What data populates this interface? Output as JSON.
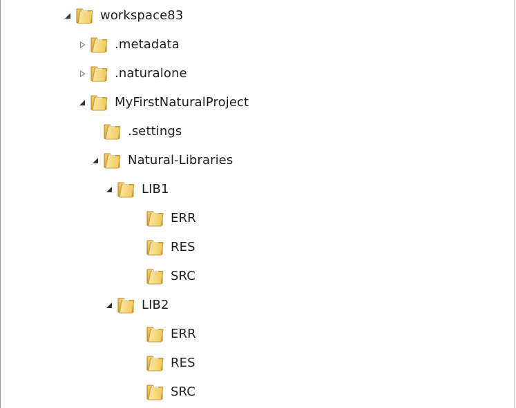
{
  "tree": {
    "nodes": [
      {
        "label": "workspace83",
        "depth": 0,
        "state": "expanded",
        "icon": "folder-icon"
      },
      {
        "label": ".metadata",
        "depth": 1,
        "state": "collapsed",
        "icon": "folder-icon"
      },
      {
        "label": ".naturalone",
        "depth": 1,
        "state": "collapsed",
        "icon": "folder-icon"
      },
      {
        "label": "MyFirstNaturalProject",
        "depth": 1,
        "state": "expanded",
        "icon": "folder-icon"
      },
      {
        "label": ".settings",
        "depth": 2,
        "state": "leaf",
        "icon": "folder-icon"
      },
      {
        "label": "Natural-Libraries",
        "depth": 2,
        "state": "expanded",
        "icon": "folder-icon"
      },
      {
        "label": "LIB1",
        "depth": 3,
        "state": "expanded",
        "icon": "folder-icon"
      },
      {
        "label": "ERR",
        "depth": 4,
        "state": "leaf",
        "icon": "folder-icon"
      },
      {
        "label": "RES",
        "depth": 4,
        "state": "leaf",
        "icon": "folder-icon"
      },
      {
        "label": "SRC",
        "depth": 4,
        "state": "leaf",
        "icon": "folder-icon"
      },
      {
        "label": "LIB2",
        "depth": 3,
        "state": "expanded",
        "icon": "folder-icon"
      },
      {
        "label": "ERR",
        "depth": 4,
        "state": "leaf",
        "icon": "folder-icon"
      },
      {
        "label": "RES",
        "depth": 4,
        "state": "leaf",
        "icon": "folder-icon"
      },
      {
        "label": "SRC",
        "depth": 4,
        "state": "leaf",
        "icon": "folder-icon"
      }
    ]
  }
}
